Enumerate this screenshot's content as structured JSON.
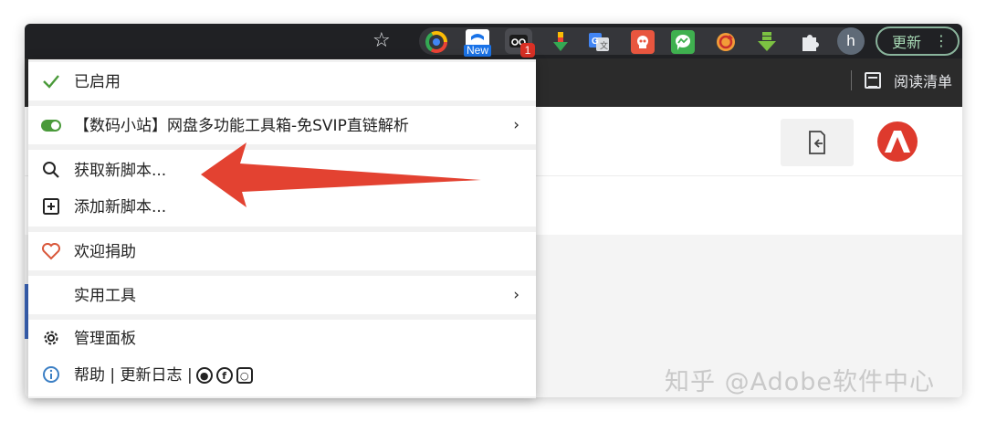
{
  "browser": {
    "update_label": "更新",
    "profile_initial": "h",
    "extensions": [
      {
        "icon": "chrome-color-icon"
      },
      {
        "icon": "new-extension-icon",
        "badge": "New"
      },
      {
        "icon": "tampermonkey-icon",
        "badge": "1"
      },
      {
        "icon": "download-arrow-icon"
      },
      {
        "icon": "google-translate-icon"
      },
      {
        "icon": "red-extension-icon"
      },
      {
        "icon": "messenger-icon"
      },
      {
        "icon": "sync-icon"
      },
      {
        "icon": "green-download-icon"
      },
      {
        "icon": "puzzle-icon"
      }
    ],
    "reading_list_label": "阅读清单"
  },
  "menu": {
    "enabled_label": "已启用",
    "script_label": "【数码小站】网盘多功能工具箱-免SVIP直链解析",
    "get_new_label": "获取新脚本...",
    "add_new_label": "添加新脚本...",
    "donate_label": "欢迎捐助",
    "utilities_label": "实用工具",
    "dashboard_label": "管理面板",
    "help_label": "帮助 | 更新日志 |"
  },
  "watermark": "知乎 @Adobe软件中心",
  "colors": {
    "toolbar": "#202124",
    "bookmarks_bar": "#2b2b2b",
    "arrow": "#e34231",
    "check": "#4a9a3a",
    "heart": "#d9573a",
    "info": "#3b7fc4",
    "adobe": "#de3a2d",
    "update_text": "#a8dab5"
  }
}
